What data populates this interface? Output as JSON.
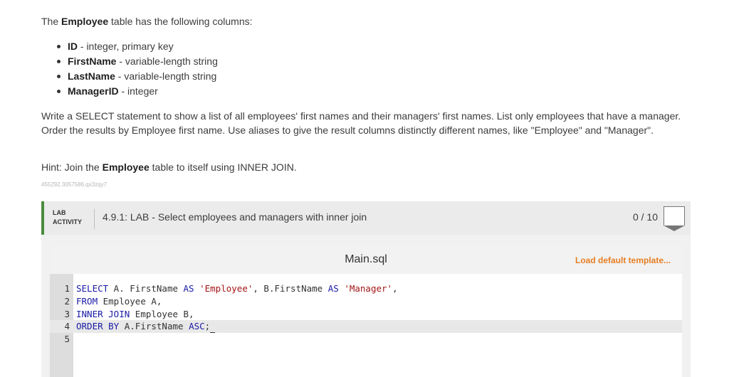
{
  "intro": {
    "pre": "The ",
    "table": "Employee",
    "post": " table has the following columns:"
  },
  "columns": [
    {
      "name": "ID",
      "desc": " - integer, primary key"
    },
    {
      "name": "FirstName",
      "desc": " - variable-length string"
    },
    {
      "name": "LastName",
      "desc": " - variable-length string"
    },
    {
      "name": "ManagerID",
      "desc": " - integer"
    }
  ],
  "task": "Write a SELECT statement to show a list of all employees' first names and their managers' first names. List only employees that have a manager. Order the results by Employee first name. Use aliases to give the result columns distinctly different names, like \"Employee\" and \"Manager\".",
  "hint": {
    "pre": "Hint: Join the ",
    "table": "Employee",
    "post": " table to itself using INNER JOIN."
  },
  "identifier": "455292.3057586.qx3zqy7",
  "lab": {
    "tag_line1": "LAB",
    "tag_line2": "ACTIVITY",
    "title": "4.9.1: LAB - Select employees and managers with inner join",
    "score": "0 / 10"
  },
  "editor": {
    "file_name": "Main.sql",
    "load_template": "Load default template...",
    "lines": [
      {
        "num": "1",
        "tokens": [
          {
            "t": "SELECT",
            "k": "kw"
          },
          {
            "t": " A. FirstName ",
            "k": ""
          },
          {
            "t": "AS",
            "k": "kw"
          },
          {
            "t": " ",
            "k": ""
          },
          {
            "t": "'Employee'",
            "k": "str"
          },
          {
            "t": ", B.FirstName ",
            "k": ""
          },
          {
            "t": "AS",
            "k": "kw"
          },
          {
            "t": " ",
            "k": ""
          },
          {
            "t": "'Manager'",
            "k": "str"
          },
          {
            "t": ",",
            "k": ""
          }
        ]
      },
      {
        "num": "2",
        "tokens": [
          {
            "t": "FROM",
            "k": "kw"
          },
          {
            "t": " Employee A,",
            "k": ""
          }
        ]
      },
      {
        "num": "3",
        "tokens": [
          {
            "t": "INNER JOIN",
            "k": "kw"
          },
          {
            "t": " Employee B,",
            "k": ""
          }
        ]
      },
      {
        "num": "4",
        "active": true,
        "tokens": [
          {
            "t": "ORDER BY",
            "k": "kw"
          },
          {
            "t": " A.FirstName ",
            "k": ""
          },
          {
            "t": "ASC",
            "k": "kw"
          },
          {
            "t": ";",
            "k": ""
          }
        ]
      },
      {
        "num": "5",
        "tokens": []
      }
    ]
  }
}
